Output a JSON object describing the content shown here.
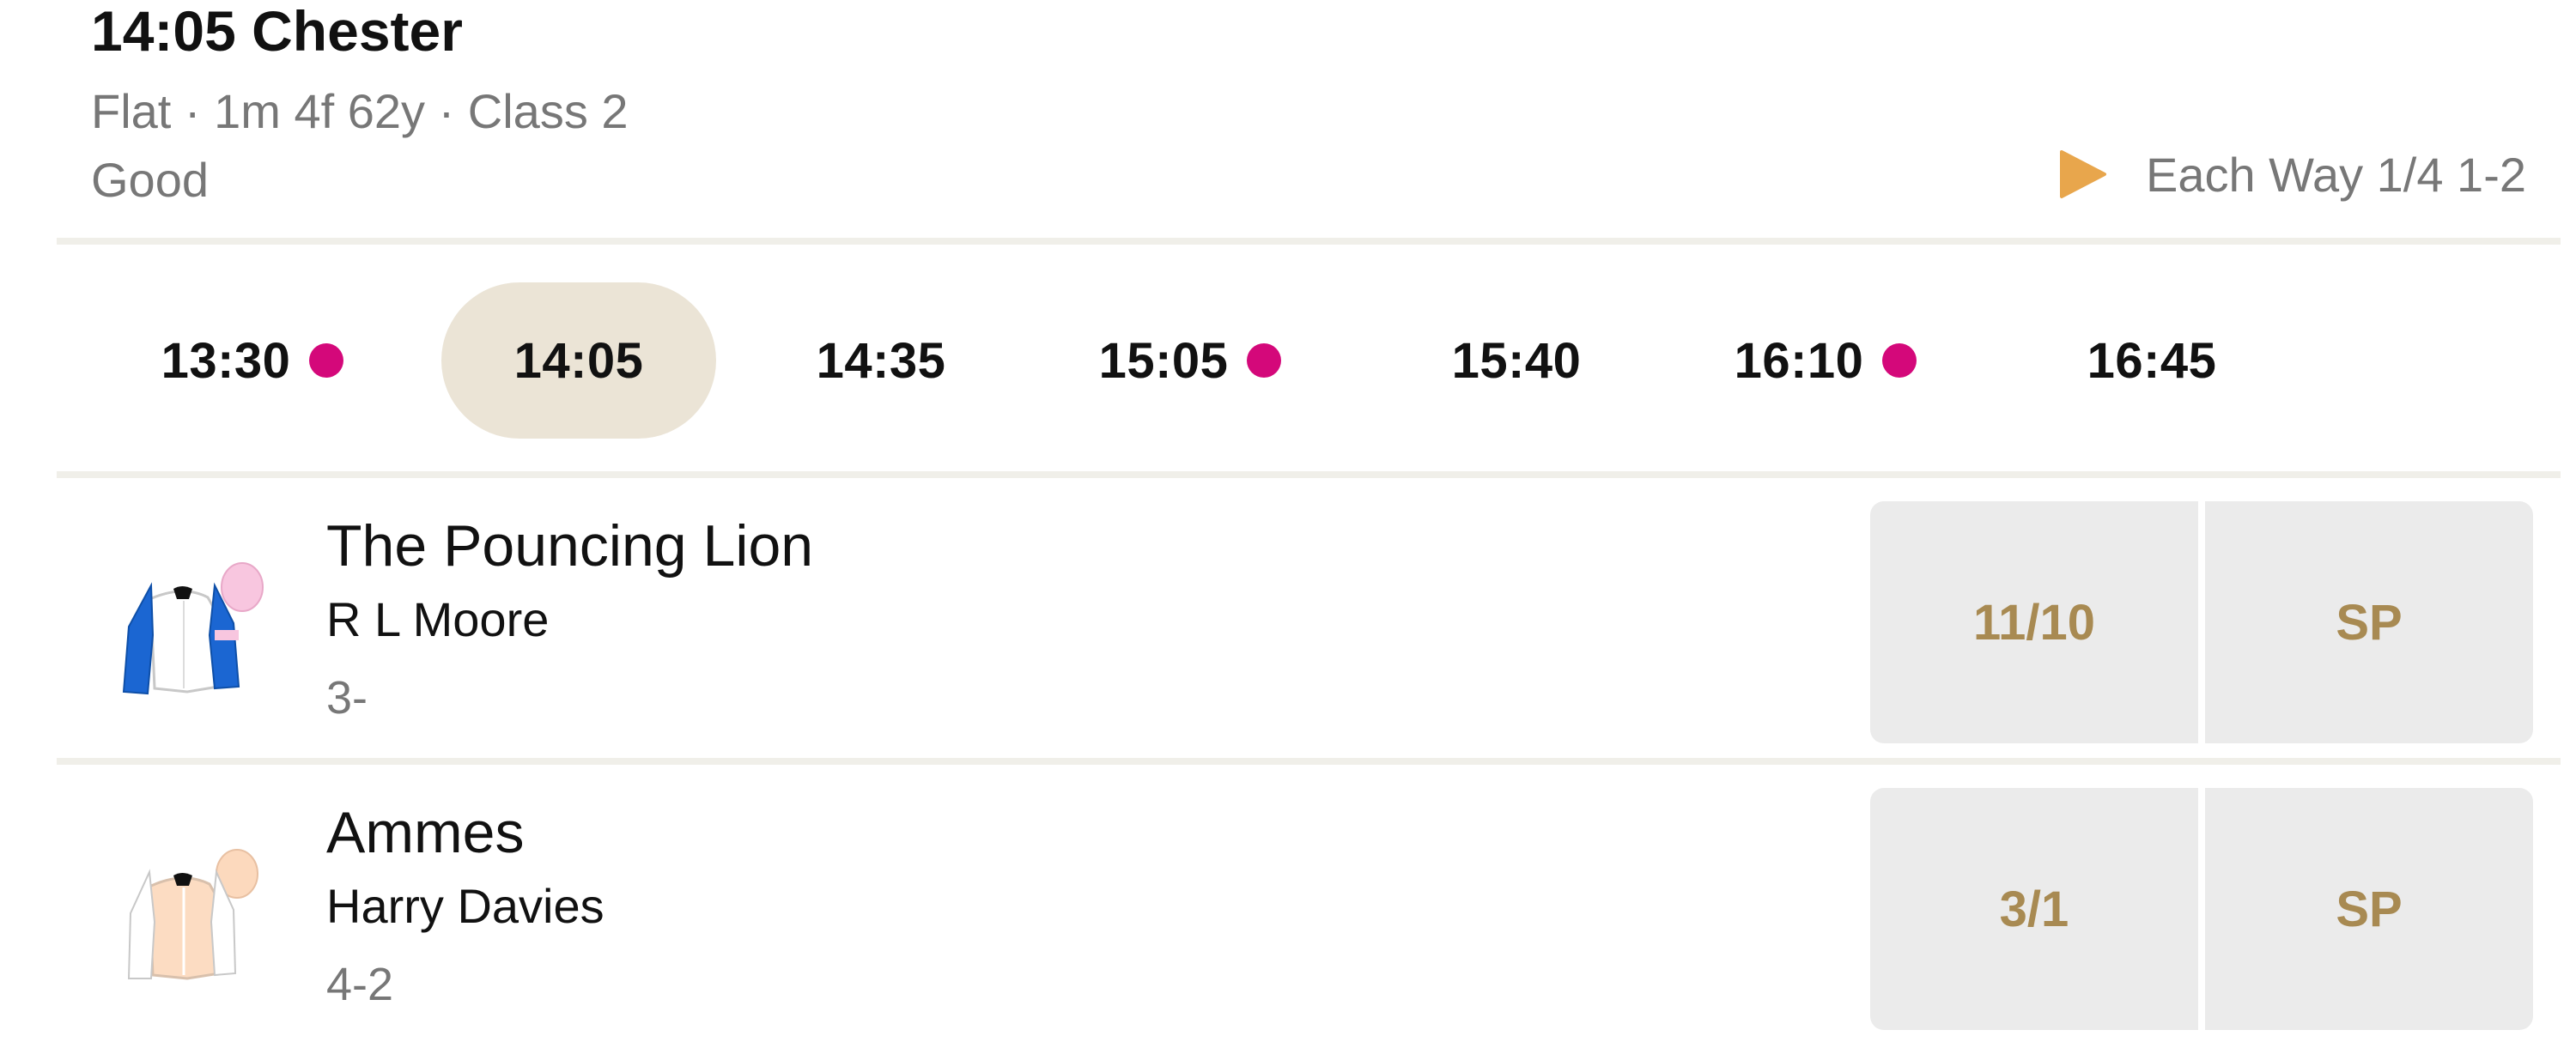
{
  "race": {
    "title": "14:05 Chester",
    "meta": "Flat · 1m 4f 62y · Class 2",
    "going": "Good",
    "each_way": "Each Way 1/4 1-2",
    "each_way_icon": "play-triangle-icon"
  },
  "colors": {
    "live_dot": "#d4087a",
    "active_tab": "#ebe4d6",
    "odds_text": "#a88a52",
    "odds_bg": "#ebebeb",
    "each_way_icon": "#e8a64c"
  },
  "race_times": [
    {
      "label": "13:30",
      "live": true,
      "active": false
    },
    {
      "label": "14:05",
      "live": false,
      "active": true
    },
    {
      "label": "14:35",
      "live": false,
      "active": false
    },
    {
      "label": "15:05",
      "live": true,
      "active": false
    },
    {
      "label": "15:40",
      "live": false,
      "active": false
    },
    {
      "label": "16:10",
      "live": true,
      "active": false
    },
    {
      "label": "16:45",
      "live": false,
      "active": false
    }
  ],
  "runners": [
    {
      "name": "The Pouncing Lion",
      "jockey": "R L Moore",
      "form": "3-",
      "price": "11/10",
      "sp": "SP",
      "silks_icon": "jockey-silks-icon"
    },
    {
      "name": "Ammes",
      "jockey": "Harry Davies",
      "form": "4-2",
      "price": "3/1",
      "sp": "SP",
      "silks_icon": "jockey-silks-icon"
    }
  ]
}
